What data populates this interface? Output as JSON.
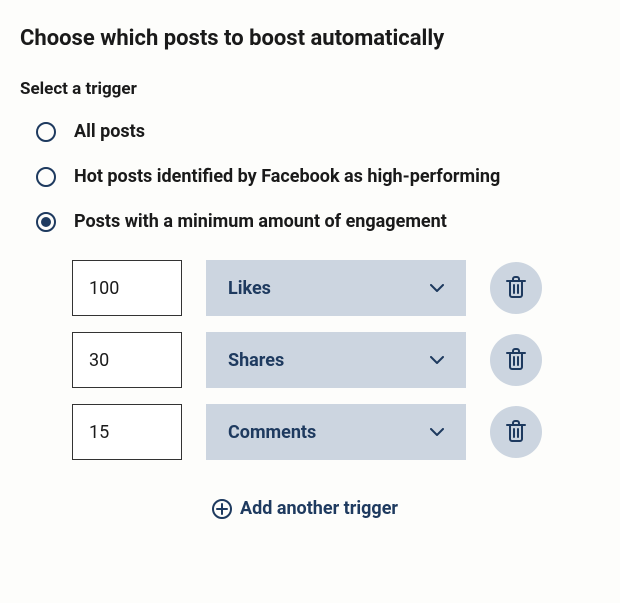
{
  "title": "Choose which posts to boost automatically",
  "section_label": "Select a trigger",
  "radio_options": [
    {
      "label": "All posts",
      "selected": false
    },
    {
      "label": "Hot posts identified by Facebook as high-performing",
      "selected": false
    },
    {
      "label": "Posts with a minimum amount of engagement",
      "selected": true
    }
  ],
  "triggers": [
    {
      "value": "100",
      "metric": "Likes"
    },
    {
      "value": "30",
      "metric": "Shares"
    },
    {
      "value": "15",
      "metric": "Comments"
    }
  ],
  "add_trigger_label": "Add another trigger",
  "colors": {
    "primary": "#1e3a5f",
    "muted_bg": "#ccd5e0"
  }
}
